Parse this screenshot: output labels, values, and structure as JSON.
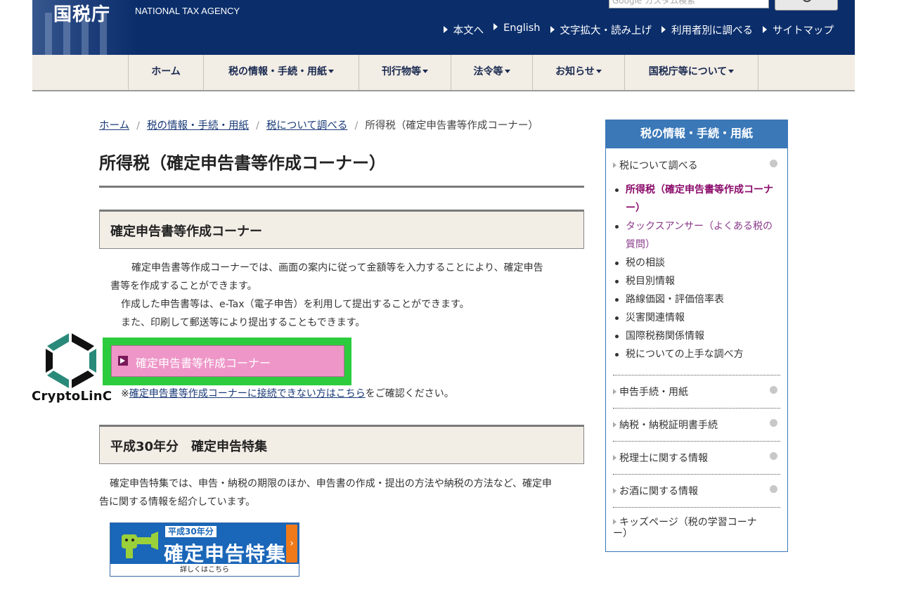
{
  "header": {
    "logo": "国税庁",
    "logo_en": "NATIONAL TAX AGENCY",
    "search_placeholder": "Google カスタム検索",
    "links": [
      "本文へ",
      "English",
      "文字拡大・読み上げ",
      "利用者別に調べる",
      "サイトマップ"
    ]
  },
  "gnav": [
    "ホーム",
    "税の情報・手続・用紙",
    "刊行物等",
    "法令等",
    "お知らせ",
    "国税庁等について"
  ],
  "breadcrumb": [
    "ホーム",
    "税の情報・手続・用紙",
    "税について調べる",
    "所得税（確定申告書等作成コーナー）"
  ],
  "main": {
    "title": "所得税（確定申告書等作成コーナー）",
    "section1": {
      "heading": "確定申告書等作成コーナー",
      "p1_line1": "確定申告書等作成コーナーでは、画面の案内に従って金額等を入力することにより、確定申告",
      "p1_line2": "書等を作成することができます。",
      "p2": "作成した申告書等は、e-Tax（電子申告）を利用して提出することができます。",
      "p3": "また、印刷して郵送等により提出することもできます。",
      "button_label": "確定申告書等作成コーナー",
      "note_prefix": "※",
      "note_link": "確定申告書等作成コーナーに接続できない方はこちら",
      "note_suffix": "をご確認ください。"
    },
    "section2": {
      "heading": "平成30年分　確定申告特集",
      "p1_line1": "確定申告特集では、申告・納税の期限のほか、申告書の作成・提出の方法や納税の方法など、確定申",
      "p1_line2": "告に関する情報を紹介しています。",
      "banner_tag": "平成30年分",
      "banner_title": "確定申告特集",
      "banner_foot": "詳しくはこちら",
      "banner_arrow": "›"
    }
  },
  "watermark": {
    "text": "CryptoLinC"
  },
  "sidebar": {
    "title": "税の情報・手続・用紙",
    "categories": [
      "税について調べる",
      "申告手続・用紙",
      "納税・納税証明書手続",
      "税理士に関する情報",
      "お酒に関する情報",
      "キッズページ（税の学習コーナー）"
    ],
    "subitems": [
      "所得税（確定申告書等作成コーナー）",
      "タックスアンサー（よくある税の質問）",
      "税の相談",
      "税目別情報",
      "路線価図・評価倍率表",
      "災害関連情報",
      "国際税務関係情報",
      "税についての上手な調べ方"
    ]
  },
  "colors": {
    "header_bg": "#0b2e6b",
    "nav_bg": "#f2ede5",
    "sidebar_accent": "#3a78b8",
    "button_pink": "#ee96c8",
    "highlight_green": "#2ccc3e",
    "current_item": "#8a0a6a"
  }
}
